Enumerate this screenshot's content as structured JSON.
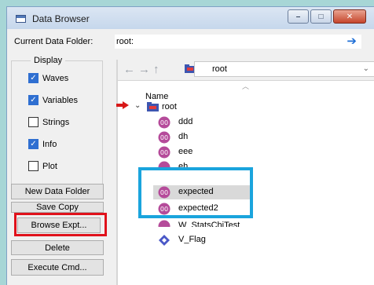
{
  "window": {
    "title": "Data Browser",
    "controls": {
      "minimize": "–",
      "maximize": "□",
      "close": "✕"
    }
  },
  "current_data_folder": {
    "label": "Current Data Folder:",
    "value": "root:"
  },
  "display": {
    "legend": "Display",
    "options": [
      {
        "label": "Waves",
        "checked": true
      },
      {
        "label": "Variables",
        "checked": true
      },
      {
        "label": "Strings",
        "checked": false
      },
      {
        "label": "Info",
        "checked": true
      },
      {
        "label": "Plot",
        "checked": false
      }
    ]
  },
  "buttons": {
    "new_data_folder": "New Data Folder",
    "save_copy": "Save Copy",
    "browse_expt": "Browse Expt...",
    "delete": "Delete",
    "execute_cmd": "Execute Cmd..."
  },
  "navigation": {
    "path_value": "root"
  },
  "tree": {
    "column_header": "Name",
    "root_label": "root",
    "items": [
      {
        "label": "ddd",
        "icon": "wave-icon",
        "selected": false
      },
      {
        "label": "dh",
        "icon": "wave-icon",
        "selected": false
      },
      {
        "label": "eee",
        "icon": "wave-icon",
        "selected": false
      },
      {
        "label": "eh",
        "icon": "wave-icon",
        "selected": false
      },
      {
        "label": "expected",
        "icon": "wave-icon",
        "selected": true
      },
      {
        "label": "expected2",
        "icon": "wave-icon",
        "selected": false
      },
      {
        "label": "W_StatsChiTest",
        "icon": "wave-icon",
        "selected": false
      },
      {
        "label": "V_Flag",
        "icon": "variable-icon",
        "selected": false
      }
    ]
  },
  "colors": {
    "highlight_red": "#e0111b",
    "highlight_blue": "#1aa4dd",
    "checkbox_blue": "#2f6fd1",
    "background": "#a7d6d6"
  }
}
